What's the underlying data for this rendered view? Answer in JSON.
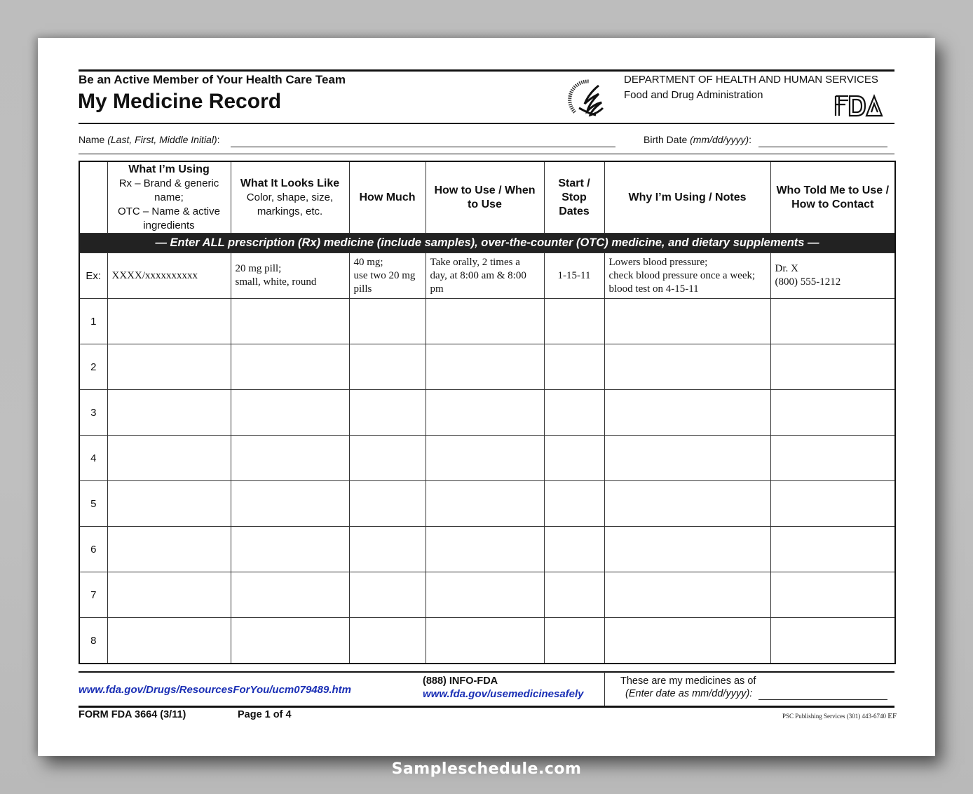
{
  "header": {
    "subtitle": "Be an Active Member of Your Health Care Team",
    "title": "My Medicine Record",
    "department": "DEPARTMENT OF HEALTH AND HUMAN SERVICES",
    "agency": "Food and Drug Administration",
    "logo_text": "FDA",
    "seal_icon": "hhs-eagle-seal-icon"
  },
  "fields": {
    "name_label": "Name ",
    "name_hint": "(Last, First, Middle Initial)",
    "name_colon": ":",
    "name_value": "",
    "birth_label": "Birth Date ",
    "birth_hint": "(mm/dd/yyyy)",
    "birth_colon": ":",
    "birth_value": ""
  },
  "table": {
    "columns": [
      {
        "title": "",
        "lines": []
      },
      {
        "title": "What I’m Using",
        "lines": [
          "Rx – Brand & generic name;",
          "OTC – Name & active ingredients"
        ]
      },
      {
        "title": "What It Looks Like",
        "lines": [
          "Color, shape, size, markings, etc."
        ]
      },
      {
        "title": "How Much",
        "lines": []
      },
      {
        "title": "How to Use / When to Use",
        "lines": []
      },
      {
        "title": "Start / Stop Dates",
        "lines": []
      },
      {
        "title": "Why I’m Using / Notes",
        "lines": []
      },
      {
        "title": "Who Told Me to Use / How to Contact",
        "lines": []
      }
    ],
    "banner": "— Enter ALL prescription (Rx) medicine (include samples), over-the-counter (OTC) medicine, and dietary supplements —",
    "example": {
      "label": "Ex:",
      "what": "XXXX/xxxxxxxxxx",
      "looks_1": "20 mg pill;",
      "looks_2": "small, white, round",
      "how_much_1": "40 mg;",
      "how_much_2": "use two 20 mg pills",
      "how_to_use": "Take orally, 2 times a day, at 8:00 am & 8:00 pm",
      "dates": "1-15-11",
      "why_1": "Lowers blood pressure;",
      "why_2": "check blood pressure once a week; blood test on 4-15-11",
      "who_1": "Dr. X",
      "who_2": "(800) 555-1212"
    },
    "rows": [
      "1",
      "2",
      "3",
      "4",
      "5",
      "6",
      "7",
      "8"
    ]
  },
  "footer": {
    "resources_link": "www.fda.gov/Drugs/ResourcesForYou/ucm079489.htm",
    "phone": "(888) INFO-FDA",
    "safe_link": "www.fda.gov/usemedicinesafely",
    "as_of_label": "These are my medicines as of",
    "as_of_hint": "(Enter date as mm/dd/yyyy):",
    "as_of_value": "",
    "form_id": "FORM FDA 3664 (3/11)",
    "page": "Page 1 of 4",
    "publisher": "PSC Publishing Services (301) 443-6740",
    "publisher_suffix": "EF"
  },
  "watermark": "Sampleschedule.com"
}
